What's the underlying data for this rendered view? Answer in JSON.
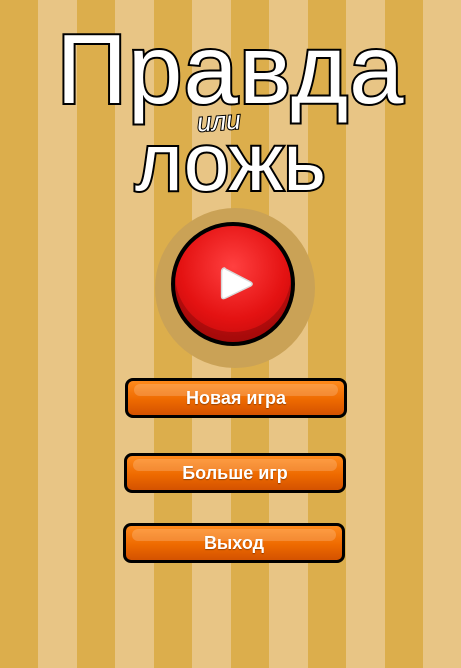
{
  "title": {
    "line1": "Правда",
    "connector": "или",
    "line2": "ложь"
  },
  "play_button": {
    "icon": "play-icon"
  },
  "menu": {
    "new_game": "Новая игра",
    "more_games": "Больше игр",
    "exit": "Выход"
  },
  "colors": {
    "stripe_dark": "#dcae4c",
    "stripe_light": "#e8c585",
    "play_red": "#e41212",
    "button_orange": "#ee6a00"
  }
}
